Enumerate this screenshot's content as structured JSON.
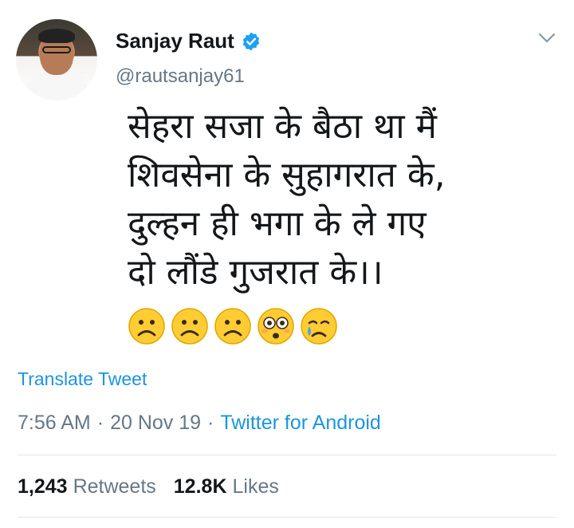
{
  "author": {
    "name": "Sanjay Raut",
    "handle": "@rautsanjay61",
    "verified": true
  },
  "tweet": {
    "lines": [
      "सेहरा सजा के बैठा था मैं",
      "शिवसेना के सुहागरात के,",
      "दुल्हन ही भगा के ले गए",
      "दो लौंडे गुजरात के।।"
    ],
    "emojis": [
      "frowning-face",
      "frowning-face",
      "frowning-face",
      "flushed-face",
      "crying-face"
    ]
  },
  "translate_label": "Translate Tweet",
  "meta": {
    "time": "7:56 AM",
    "date": "20 Nov 19",
    "separator": "·",
    "source": "Twitter for Android"
  },
  "stats": {
    "retweets_count": "1,243",
    "retweets_label": "Retweets",
    "likes_count": "12.8K",
    "likes_label": "Likes"
  },
  "colors": {
    "link": "#1b95e0",
    "secondary_text": "#657786",
    "primary_text": "#14171a",
    "emoji_yellow": "#ffcc33"
  }
}
